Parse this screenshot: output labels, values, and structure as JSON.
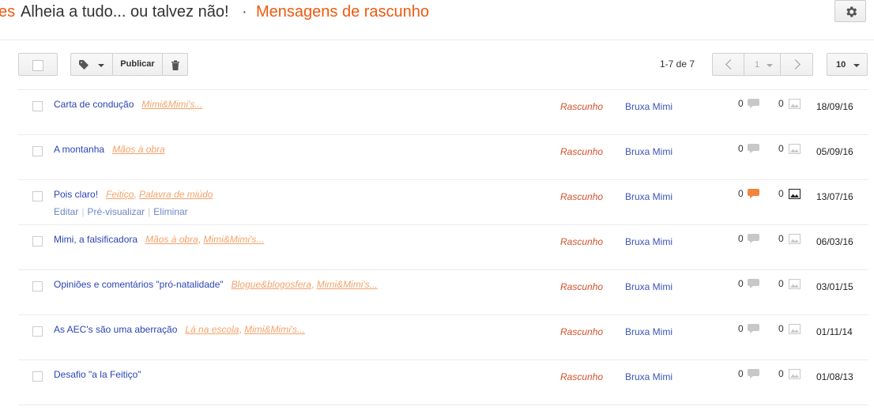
{
  "header": {
    "breadcrumb_prev": "es",
    "blog_title": "Alheia a tudo... ou talvez não!",
    "separator": "·",
    "page_title": "Mensagens de rascunho",
    "settings_icon": "gear-icon"
  },
  "toolbar": {
    "publish_label": "Publicar",
    "label_icon": "tag-icon",
    "delete_icon": "trash-icon"
  },
  "pagination": {
    "range": "1-7 de 7",
    "page": "1",
    "per_page": "10"
  },
  "row_actions": {
    "edit": "Editar",
    "preview": "Pré-visualizar",
    "delete": "Eliminar"
  },
  "posts": [
    {
      "title": "Carta de condução",
      "labels": [
        "Mimi&Mimi's..."
      ],
      "status": "Rascunho",
      "author": "Bruxa Mimi",
      "comments": "0",
      "images": "0",
      "date": "18/09/16"
    },
    {
      "title": "A montanha",
      "labels": [
        "Mãos à obra"
      ],
      "status": "Rascunho",
      "author": "Bruxa Mimi",
      "comments": "0",
      "images": "0",
      "date": "05/09/16"
    },
    {
      "title": "Pois claro!",
      "labels": [
        "Feitiço",
        "Palavra de miúdo"
      ],
      "status": "Rascunho",
      "author": "Bruxa Mimi",
      "comments": "0",
      "images": "0",
      "date": "13/07/16",
      "hovered": true
    },
    {
      "title": "Mimi, a falsificadora",
      "labels": [
        "Mãos à obra",
        "Mimi&Mimi's..."
      ],
      "status": "Rascunho",
      "author": "Bruxa Mimi",
      "comments": "0",
      "images": "0",
      "date": "06/03/16"
    },
    {
      "title": "Opiniões e comentários \"pró-natalidade\"",
      "labels": [
        "Blogue&blogosfera",
        "Mimi&Mimi's..."
      ],
      "status": "Rascunho",
      "author": "Bruxa Mimi",
      "comments": "0",
      "images": "0",
      "date": "03/01/15"
    },
    {
      "title": "As AEC's são uma aberração",
      "labels": [
        "Lá na escola",
        "Mimi&Mimi's..."
      ],
      "status": "Rascunho",
      "author": "Bruxa Mimi",
      "comments": "0",
      "images": "0",
      "date": "01/11/14"
    },
    {
      "title": "Desafio \"a la Feitiço\"",
      "labels": [],
      "status": "Rascunho",
      "author": "Bruxa Mimi",
      "comments": "0",
      "images": "0",
      "date": "01/08/13"
    }
  ],
  "colors": {
    "accent": "#ee5a0f",
    "link": "#2a44b5",
    "status": "#d3512b",
    "label": "#f4a26a",
    "comment_active": "#f4843c"
  }
}
